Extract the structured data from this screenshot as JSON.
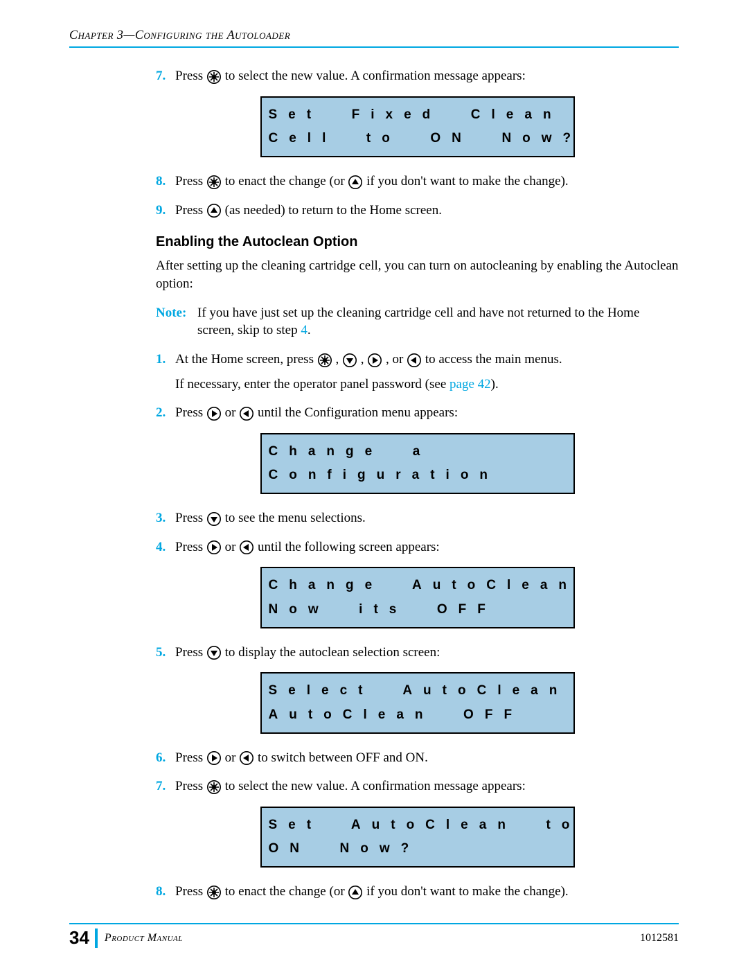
{
  "header": {
    "chapter": "Chapter 3—Configuring the Autoloader"
  },
  "steps_top": {
    "s7": {
      "num": "7.",
      "a": "Press ",
      "b": " to select the new value. A confirmation message appears:"
    },
    "lcd1": "Set  Fixed  Clean\nCell  to  ON  Now?",
    "s8": {
      "num": "8.",
      "a": "Press ",
      "b": " to enact the change (or ",
      "c": " if you don't want to make the change)."
    },
    "s9": {
      "num": "9.",
      "a": "Press ",
      "b": " (as needed) to return to the Home screen."
    }
  },
  "section": {
    "heading": "Enabling the Autoclean Option",
    "intro": "After setting up the cleaning cartridge cell, you can turn on autocleaning by enabling the Autoclean option:",
    "note_label": "Note:",
    "note_text_a": "If you have just set up the cleaning cartridge cell and have not returned to the Home screen, skip to step ",
    "note_step_link": "4",
    "note_text_b": "."
  },
  "steps": {
    "s1": {
      "num": "1.",
      "a": "At the Home screen, press ",
      "b": ", ",
      "c": ", ",
      "d": ", or ",
      "e": " to access the main menus.",
      "sub_a": "If necessary, enter the operator panel password (see ",
      "sub_link": "page 42",
      "sub_b": ")."
    },
    "s2": {
      "num": "2.",
      "a": "Press ",
      "b": " or ",
      "c": " until the Configuration menu appears:"
    },
    "lcd2": "Change  a\nConfiguration",
    "s3": {
      "num": "3.",
      "a": "Press ",
      "b": " to see the menu selections."
    },
    "s4": {
      "num": "4.",
      "a": "Press ",
      "b": " or ",
      "c": " until the following screen appears:"
    },
    "lcd3": "Change  AutoClean\nNow  its  OFF",
    "s5": {
      "num": "5.",
      "a": "Press ",
      "b": " to display the autoclean selection screen:"
    },
    "lcd4": "Select  AutoClean\nAutoClean  OFF",
    "s6": {
      "num": "6.",
      "a": "Press ",
      "b": " or ",
      "c": " to switch between OFF and ON."
    },
    "s7": {
      "num": "7.",
      "a": "Press ",
      "b": " to select the new value. A confirmation message appears:"
    },
    "lcd5": "Set  AutoClean  to\nON  Now?",
    "s8": {
      "num": "8.",
      "a": "Press ",
      "b": " to enact the change (or ",
      "c": " if you don't want to make the change)."
    }
  },
  "footer": {
    "page_num": "34",
    "product_manual": "Product Manual",
    "doc_num": "1012581"
  }
}
